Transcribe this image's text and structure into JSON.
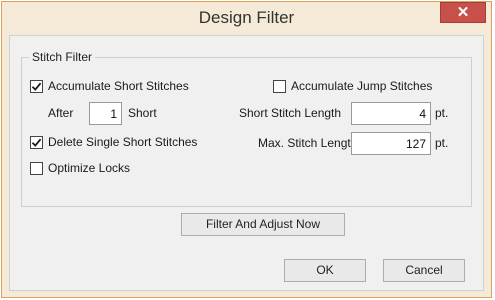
{
  "window": {
    "title": "Design Filter",
    "close_glyph": "✕"
  },
  "stitch_filter": {
    "legend": "Stitch Filter",
    "accumulate_short": {
      "label": "Accumulate Short Stitches",
      "checked": true
    },
    "accumulate_jump": {
      "label": "Accumulate Jump Stitches",
      "checked": false
    },
    "after": {
      "prefix": "After",
      "value": "1",
      "suffix": "Short"
    },
    "short_stitch_length": {
      "label": "Short Stitch Length",
      "value": "4",
      "unit": "pt."
    },
    "delete_single_short": {
      "label": "Delete Single Short Stitches",
      "checked": true
    },
    "max_stitch_length": {
      "label": "Max. Stitch Length",
      "value": "127",
      "unit": "pt."
    },
    "optimize_locks": {
      "label": "Optimize Locks",
      "checked": false
    }
  },
  "buttons": {
    "filter_adjust": "Filter And Adjust Now",
    "ok": "OK",
    "cancel": "Cancel"
  },
  "colors": {
    "frame": "#d7a35a",
    "close_button": "#c7504a",
    "client_bg": "#f0f0f0"
  }
}
